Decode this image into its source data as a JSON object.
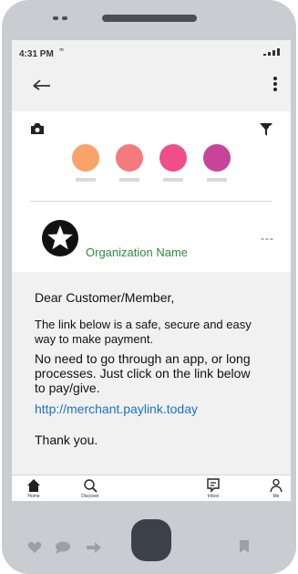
{
  "status_bar": {
    "time": "4:31 PM",
    "signal": "ꟹ"
  },
  "org": {
    "name": "Organization Name",
    "menu": "---"
  },
  "stories": [
    {
      "color": "#f8a36a"
    },
    {
      "color": "#f57a7e"
    },
    {
      "color": "#ef4e86"
    },
    {
      "color": "#c6459a"
    }
  ],
  "message": {
    "greeting": "Dear Customer/Member,",
    "paragraph1": "The link below is a safe, secure and easy way to make payment.",
    "paragraph2": "No need to go through an app, or long processes. Just click on the link below to pay/give.",
    "link": "http://merchant.paylink.today",
    "closing": "Thank you."
  },
  "tabs": [
    {
      "label": "Home",
      "icon": "home-icon"
    },
    {
      "label": "Discover",
      "icon": "search-icon"
    },
    {
      "label": "Inbox",
      "icon": "inbox-icon"
    },
    {
      "label": "Me",
      "icon": "person-icon"
    }
  ],
  "colors": {
    "accent_link": "#1a73c8",
    "org_name": "#2e8b3e",
    "phone_frame": "#c9ccd1",
    "screen_bg": "#f1f1f1"
  }
}
